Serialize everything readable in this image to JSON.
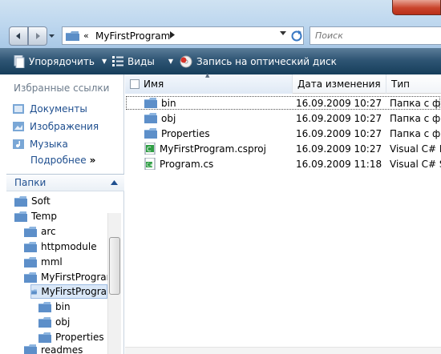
{
  "address": {
    "crumb_prefix": "«",
    "current_folder": "MyFirstProgram"
  },
  "search": {
    "placeholder": "Поиск"
  },
  "toolbar": {
    "organize": "Упорядочить",
    "views": "Виды",
    "burn": "Запись на оптический диск"
  },
  "favorites": {
    "title": "Избранные ссылки",
    "items": [
      "Документы",
      "Изображения",
      "Музыка"
    ],
    "more": "Подробнее",
    "more_glyph": "»"
  },
  "folders": {
    "title": "Папки",
    "tree": [
      {
        "label": "Soft"
      },
      {
        "label": "Temp"
      },
      {
        "label": "arc"
      },
      {
        "label": "httpmodule"
      },
      {
        "label": "mml"
      },
      {
        "label": "MyFirstProgram"
      },
      {
        "label": "MyFirstProgra"
      },
      {
        "label": "bin"
      },
      {
        "label": "obj"
      },
      {
        "label": "Properties"
      },
      {
        "label": "readmes"
      }
    ]
  },
  "columns": {
    "name": "Имя",
    "modified": "Дата изменения",
    "type": "Тип"
  },
  "files": [
    {
      "name": "bin",
      "modified": "16.09.2009 10:27",
      "type": "Папка с фа",
      "icon": "folder-icon"
    },
    {
      "name": "obj",
      "modified": "16.09.2009 10:27",
      "type": "Папка с фа",
      "icon": "folder-icon"
    },
    {
      "name": "Properties",
      "modified": "16.09.2009 10:27",
      "type": "Папка с фа",
      "icon": "folder-icon"
    },
    {
      "name": "MyFirstProgram.csproj",
      "modified": "16.09.2009 10:27",
      "type": "Visual C# Pr",
      "icon": "csproj-icon"
    },
    {
      "name": "Program.cs",
      "modified": "16.09.2009 11:18",
      "type": "Visual C# Sc",
      "icon": "cs-file-icon"
    }
  ]
}
